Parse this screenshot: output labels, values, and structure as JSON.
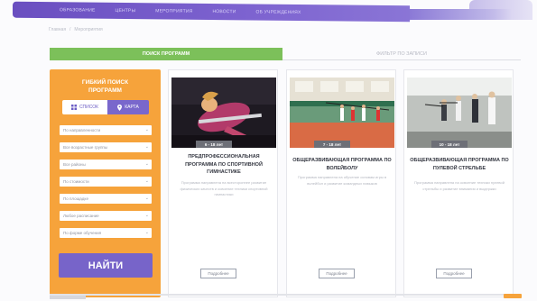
{
  "nav": {
    "items": [
      "ОБРАЗОВАНИЕ",
      "ЦЕНТРЫ",
      "МЕРОПРИЯТИЯ",
      "НОВОСТИ",
      "ОБ УЧРЕЖДЕНИЯХ"
    ],
    "accent": "#7357c6"
  },
  "breadcrumb": [
    "Главная",
    "/",
    "Мероприятия"
  ],
  "tabs": {
    "active": "ПОИСК ПРОГРАММ",
    "inactive": "ФИЛЬТР ПО ЗАПИСИ"
  },
  "search": {
    "title_line1": "ГИБКИЙ ПОИСК",
    "title_line2": "ПРОГРАММ",
    "mode_list": "СПИСОК",
    "mode_map": "КАРТА",
    "selects": [
      "По направленности",
      "Все возрастные группы",
      "Все районы",
      "По стоимости",
      "По площадке",
      "Любое расписание",
      "По форме обучения"
    ],
    "find_label": "НАЙТИ",
    "panel_color": "#f6a33b",
    "button_color": "#7764c9"
  },
  "cards": [
    {
      "date": "6 - 18 лет",
      "title": "ПРЕДПРОФЕССИОНАЛЬНАЯ ПРОГРАММА ПО СПОРТИВНОЙ ГИМНАСТИКЕ",
      "desc": "Программа направлена на всестороннее развитие физических качеств и освоение техники спортивной гимнастики",
      "button": "Подробнее",
      "image": "gymnast-photo"
    },
    {
      "date": "7 - 18 лет",
      "title": "ОБЩЕРАЗВИВАЮЩАЯ ПРОГРАММА ПО ВОЛЕЙБОЛУ",
      "desc": "Программа направлена на обучение основам игры в волейбол и развитие командных навыков",
      "button": "Подробнее",
      "image": "volleyball-photo"
    },
    {
      "date": "10 - 18 лет",
      "title": "ОБЩЕРАЗВИВАЮЩАЯ ПРОГРАММА ПО ПУЛЕВОЙ СТРЕЛЬБЕ",
      "desc": "Программа направлена на освоение техники пулевой стрельбы и развитие внимания и выдержки",
      "button": "Подробнее",
      "image": "shooting-range-photo"
    }
  ],
  "colors": {
    "green_tab": "#7cc05a",
    "date_badge": "#6d6f77"
  }
}
